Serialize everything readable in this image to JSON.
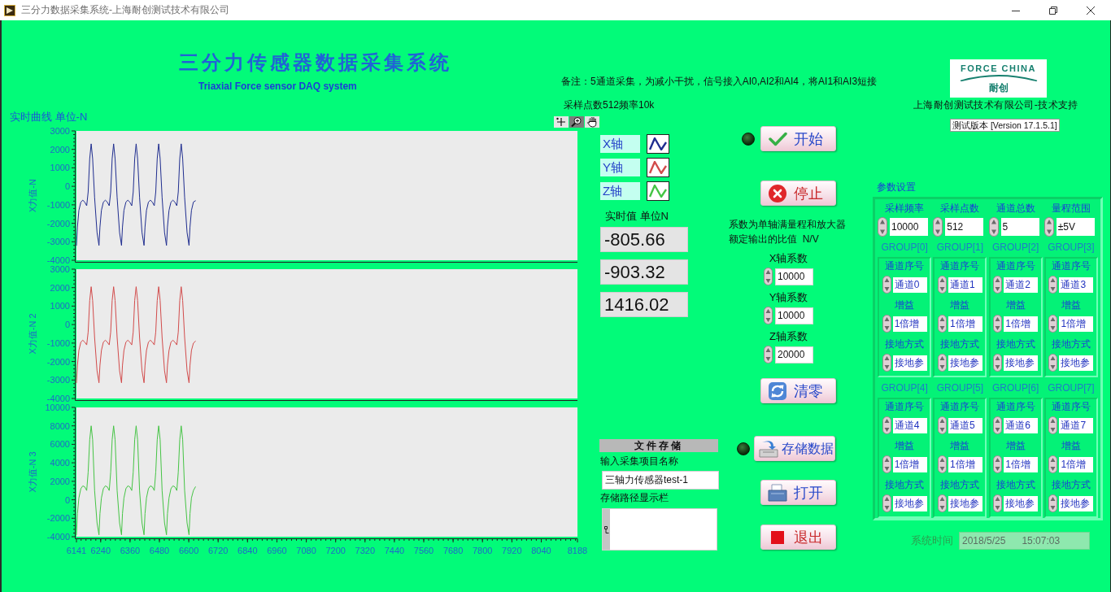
{
  "window": {
    "title": "三分力数据采集系统-上海耐创测试技术有限公司"
  },
  "header": {
    "title": "三分力传感器数据采集系统",
    "subtitle": "Triaxial Force sensor DAQ system",
    "notes": [
      "备注：5通道采集，为减小干扰，信号接入AI0,AI2和AI4，将AI1和AI3短接",
      "采样点数512频率10k"
    ]
  },
  "logo": {
    "brand": "FORCE CHINA",
    "name": "耐创"
  },
  "support": "上海耐创测试技术有限公司-技术支持",
  "version": "测试版本 [Version 17.1.5.1]",
  "charts_panel": {
    "label": "实时曲线 单位-N",
    "charts": [
      {
        "chart_data": {
          "type": "line",
          "ylabel": "X力值-N",
          "x": [
            6141,
            6145,
            6151,
            6159,
            6167,
            6175,
            6183,
            6189,
            6195,
            6201,
            6207,
            6215,
            6225,
            6233,
            6237,
            6243,
            6251,
            6259,
            6267,
            6275,
            6281,
            6287,
            6293,
            6299,
            6307,
            6317,
            6325,
            6329,
            6335,
            6343,
            6351,
            6359,
            6367,
            6373,
            6379,
            6385,
            6391,
            6399,
            6409,
            6417,
            6421,
            6427,
            6435,
            6443,
            6451,
            6459,
            6465,
            6471,
            6477,
            6483,
            6491,
            6501,
            6509,
            6513,
            6519,
            6527,
            6535,
            6543,
            6551,
            6557,
            6563,
            6569,
            6575,
            6583,
            6593,
            6601,
            6605,
            6611,
            6619,
            6627
          ],
          "series": [
            {
              "color": "#1f2d8f",
              "values": [
                -3200,
                -2200,
                -1300,
                -850,
                -750,
                -850,
                -1050,
                -300,
                1500,
                2300,
                1500,
                -600,
                -2500,
                -3200,
                -2200,
                -1300,
                -850,
                -750,
                -850,
                -1050,
                -300,
                1500,
                2300,
                1500,
                -600,
                -2500,
                -3200,
                -2200,
                -1300,
                -850,
                -750,
                -850,
                -1050,
                -300,
                1500,
                2300,
                1500,
                -600,
                -2500,
                -3200,
                -2200,
                -1300,
                -850,
                -750,
                -850,
                -1050,
                -300,
                1500,
                2300,
                1500,
                -600,
                -2500,
                -3200,
                -2200,
                -1300,
                -850,
                -750,
                -850,
                -1050,
                -300,
                1500,
                2300,
                1500,
                -600,
                -2500,
                -3200,
                -2200,
                -1300,
                -850,
                -780
              ]
            }
          ],
          "xlim": [
            6141,
            8188
          ],
          "ylim": [
            -4000,
            3000
          ],
          "yticks": [
            -4000,
            -3000,
            -2000,
            -1000,
            0,
            1000,
            2000,
            3000
          ]
        }
      },
      {
        "chart_data": {
          "type": "line",
          "ylabel": "X力值-N 2",
          "x": [
            6141,
            6145,
            6151,
            6159,
            6167,
            6175,
            6183,
            6189,
            6195,
            6201,
            6207,
            6215,
            6225,
            6233,
            6237,
            6243,
            6251,
            6259,
            6267,
            6275,
            6281,
            6287,
            6293,
            6299,
            6307,
            6317,
            6325,
            6329,
            6335,
            6343,
            6351,
            6359,
            6367,
            6373,
            6379,
            6385,
            6391,
            6399,
            6409,
            6417,
            6421,
            6427,
            6435,
            6443,
            6451,
            6459,
            6465,
            6471,
            6477,
            6483,
            6491,
            6501,
            6509,
            6513,
            6519,
            6527,
            6535,
            6543,
            6551,
            6557,
            6563,
            6569,
            6575,
            6583,
            6593,
            6601,
            6605,
            6611,
            6619,
            6627
          ],
          "series": [
            {
              "color": "#d24b4b",
              "values": [
                -3150,
                -2200,
                -1400,
                -950,
                -850,
                -950,
                -1100,
                -400,
                1300,
                2050,
                1300,
                -700,
                -2500,
                -3150,
                -2200,
                -1400,
                -950,
                -850,
                -950,
                -1100,
                -400,
                1300,
                2050,
                1300,
                -700,
                -2500,
                -3150,
                -2200,
                -1400,
                -950,
                -850,
                -950,
                -1100,
                -400,
                1300,
                2050,
                1300,
                -700,
                -2500,
                -3150,
                -2200,
                -1400,
                -950,
                -850,
                -950,
                -1100,
                -400,
                1300,
                2050,
                1300,
                -700,
                -2500,
                -3150,
                -2200,
                -1400,
                -950,
                -850,
                -950,
                -1100,
                -400,
                1300,
                2050,
                1300,
                -700,
                -2500,
                -3150,
                -2200,
                -1400,
                -1000,
                -900
              ]
            }
          ],
          "xlim": [
            6141,
            8188
          ],
          "ylim": [
            -4000,
            3000
          ],
          "yticks": [
            -4000,
            -3000,
            -2000,
            -1000,
            0,
            1000,
            2000,
            3000
          ]
        }
      },
      {
        "chart_data": {
          "type": "line",
          "ylabel": "X力值-N 3",
          "x": [
            6141,
            6145,
            6151,
            6159,
            6167,
            6175,
            6183,
            6189,
            6195,
            6201,
            6207,
            6215,
            6225,
            6233,
            6237,
            6243,
            6251,
            6259,
            6267,
            6275,
            6281,
            6287,
            6293,
            6299,
            6307,
            6317,
            6325,
            6329,
            6335,
            6343,
            6351,
            6359,
            6367,
            6373,
            6379,
            6385,
            6391,
            6399,
            6409,
            6417,
            6421,
            6427,
            6435,
            6443,
            6451,
            6459,
            6465,
            6471,
            6477,
            6483,
            6491,
            6501,
            6509,
            6513,
            6519,
            6527,
            6535,
            6543,
            6551,
            6557,
            6563,
            6569,
            6575,
            6583,
            6593,
            6601,
            6605,
            6611,
            6619,
            6627
          ],
          "series": [
            {
              "color": "#45c445",
              "values": [
                -3800,
                -1500,
                200,
                1200,
                1500,
                1400,
                1000,
                3000,
                6500,
                8000,
                6500,
                1000,
                -2500,
                -3800,
                -1500,
                200,
                1200,
                1500,
                1400,
                1000,
                3000,
                6500,
                8000,
                6500,
                1000,
                -2500,
                -3800,
                -1500,
                200,
                1200,
                1500,
                1400,
                1000,
                3000,
                6500,
                8000,
                6500,
                1000,
                -2500,
                -3800,
                -1500,
                200,
                1200,
                1500,
                1400,
                1000,
                3000,
                6500,
                8000,
                6500,
                1000,
                -2500,
                -3800,
                -1500,
                200,
                1200,
                1500,
                1400,
                1000,
                3000,
                6500,
                8000,
                6500,
                1000,
                -2500,
                -3800,
                -1500,
                200,
                1000,
                1400
              ]
            }
          ],
          "xlim": [
            6141,
            8188
          ],
          "ylim": [
            -4000,
            10000
          ],
          "yticks": [
            -4000,
            -2000,
            0,
            2000,
            4000,
            6000,
            8000,
            10000
          ],
          "xticks": [
            6141,
            6240,
            6360,
            6480,
            6600,
            6720,
            6840,
            6960,
            7080,
            7200,
            7320,
            7440,
            7560,
            7680,
            7800,
            7920,
            8040,
            8188
          ]
        }
      }
    ]
  },
  "legend": [
    {
      "label": "X轴",
      "color": "#1f2d8f"
    },
    {
      "label": "Y轴",
      "color": "#d24b4b"
    },
    {
      "label": "Z轴",
      "color": "#45c445"
    }
  ],
  "realtime": {
    "label": "实时值 单位N",
    "values": [
      "-805.66",
      "-903.32",
      "1416.02"
    ]
  },
  "file_storage": {
    "title": "文件存储",
    "name_label": "输入采集项目名称",
    "name_value": "三轴力传感器test-1",
    "path_label": "存储路径显示栏"
  },
  "controls": [
    {
      "kind": "start",
      "label": "开始",
      "indicator_on": false
    },
    {
      "kind": "stop",
      "label": "停止"
    },
    {
      "kind": "note",
      "text": "系数为单轴满量程和放大器额定输出的比值  N/V"
    },
    {
      "kind": "coefficient",
      "label": "X轴系数",
      "value": "10000"
    },
    {
      "kind": "coefficient",
      "label": "Y轴系数",
      "value": "10000"
    },
    {
      "kind": "coefficient",
      "label": "Z轴系数",
      "value": "20000"
    },
    {
      "kind": "reset",
      "label": "清零"
    }
  ],
  "file_buttons": [
    {
      "kind": "save",
      "label": "存储数据",
      "indicator_on": false
    },
    {
      "kind": "open",
      "label": "打开"
    },
    {
      "kind": "exit",
      "label": "退出"
    }
  ],
  "parameters": {
    "title": "参数设置",
    "fields": [
      {
        "label": "采样频率",
        "value": "10000"
      },
      {
        "label": "采样点数",
        "value": "512"
      },
      {
        "label": "通道总数",
        "value": "5"
      },
      {
        "label": "量程范围",
        "value": "±5V"
      }
    ],
    "groups": [
      {
        "title": "GROUP[0]",
        "fields": [
          {
            "label": "通道序号",
            "value": "通道0"
          },
          {
            "label": "增益",
            "value": "1倍增"
          },
          {
            "label": "接地方式",
            "value": "接地参"
          }
        ]
      },
      {
        "title": "GROUP[1]",
        "fields": [
          {
            "label": "通道序号",
            "value": "通道1"
          },
          {
            "label": "增益",
            "value": "1倍增"
          },
          {
            "label": "接地方式",
            "value": "接地参"
          }
        ]
      },
      {
        "title": "GROUP[2]",
        "fields": [
          {
            "label": "通道序号",
            "value": "通道2"
          },
          {
            "label": "增益",
            "value": "1倍增"
          },
          {
            "label": "接地方式",
            "value": "接地参"
          }
        ]
      },
      {
        "title": "GROUP[3]",
        "fields": [
          {
            "label": "通道序号",
            "value": "通道3"
          },
          {
            "label": "增益",
            "value": "1倍增"
          },
          {
            "label": "接地方式",
            "value": "接地参"
          }
        ]
      },
      {
        "title": "GROUP[4]",
        "fields": [
          {
            "label": "通道序号",
            "value": "通道4"
          },
          {
            "label": "增益",
            "value": "1倍增"
          },
          {
            "label": "接地方式",
            "value": "接地参"
          }
        ]
      },
      {
        "title": "GROUP[5]",
        "fields": [
          {
            "label": "通道序号",
            "value": "通道5"
          },
          {
            "label": "增益",
            "value": "1倍增"
          },
          {
            "label": "接地方式",
            "value": "接地参"
          }
        ]
      },
      {
        "title": "GROUP[6]",
        "fields": [
          {
            "label": "通道序号",
            "value": "通道6"
          },
          {
            "label": "增益",
            "value": "1倍增"
          },
          {
            "label": "接地方式",
            "value": "接地参"
          }
        ]
      },
      {
        "title": "GROUP[7]",
        "fields": [
          {
            "label": "通道序号",
            "value": "通道7"
          },
          {
            "label": "增益",
            "value": "1倍增"
          },
          {
            "label": "接地方式",
            "value": "接地参"
          }
        ]
      }
    ]
  },
  "system_time": {
    "label": "系统时间",
    "value": "2018/5/25      15:07:03"
  }
}
